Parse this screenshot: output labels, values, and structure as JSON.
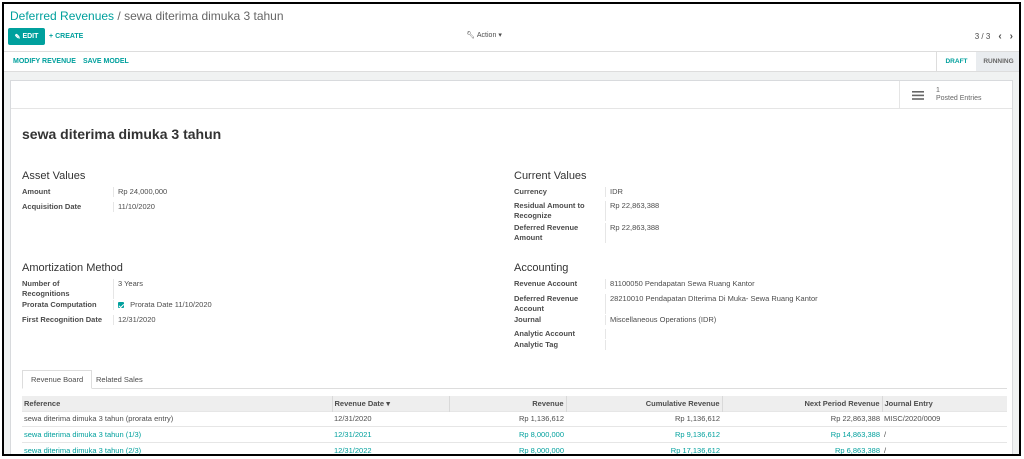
{
  "breadcrumb": {
    "parent": "Deferred Revenues",
    "separator": "/",
    "current": "sewa diterima dimuka 3 tahun"
  },
  "toolbar": {
    "edit_label": "EDIT",
    "create_label": "CREATE",
    "action_label": "Action",
    "pager": "3 / 3"
  },
  "header": {
    "modify_label": "MODIFY REVENUE",
    "save_model_label": "SAVE MODEL",
    "stages": [
      "DRAFT",
      "RUNNING"
    ],
    "active_stage": "RUNNING"
  },
  "stat": {
    "count": "1",
    "label": "Posted Entries"
  },
  "title": "sewa diterima dimuka 3 tahun",
  "asset_values": {
    "title": "Asset Values",
    "amount_label": "Amount",
    "amount": "Rp 24,000,000",
    "acq_label": "Acquisition Date",
    "acq": "11/10/2020"
  },
  "current_values": {
    "title": "Current Values",
    "currency_label": "Currency",
    "currency": "IDR",
    "residual_label_1": "Residual Amount to",
    "residual_label_2": "Recognize",
    "residual": "Rp 22,863,388",
    "deferred_label_1": "Deferred Revenue",
    "deferred_label_2": "Amount",
    "deferred": "Rp 22,863,388"
  },
  "amortization": {
    "title": "Amortization Method",
    "num_label_1": "Number of",
    "num_label_2": "Recognitions",
    "num": "3 Years",
    "prorata_label": "Prorata Computation",
    "prorata_date_label": "Prorata Date",
    "prorata_date": "11/10/2020",
    "first_label": "First Recognition Date",
    "first": "12/31/2020"
  },
  "accounting": {
    "title": "Accounting",
    "rev_acc_label": "Revenue Account",
    "rev_acc": "81100050 Pendapatan Sewa Ruang Kantor",
    "def_acc_label_1": "Deferred Revenue",
    "def_acc_label_2": "Account",
    "def_acc": "28210010 Pendapatan DIterima Di Muka- Sewa Ruang Kantor",
    "journal_label": "Journal",
    "journal": "Miscellaneous Operations (IDR)",
    "analytic_acc_label": "Analytic Account",
    "analytic_tag_label": "Analytic Tag"
  },
  "tabs": [
    "Revenue Board",
    "Related Sales"
  ],
  "table": {
    "headers": [
      "Reference",
      "Revenue Date",
      "Revenue",
      "Cumulative Revenue",
      "Next Period Revenue",
      "Journal Entry"
    ],
    "rows": [
      {
        "ref": "sewa diterima dimuka 3 tahun (prorata entry)",
        "date": "12/31/2020",
        "rev": "Rp 1,136,612",
        "cum": "Rp 1,136,612",
        "next": "Rp 22,863,388",
        "je": "MISC/2020/0009"
      },
      {
        "ref": "sewa diterima dimuka 3 tahun (1/3)",
        "date": "12/31/2021",
        "rev": "Rp 8,000,000",
        "cum": "Rp 9,136,612",
        "next": "Rp 14,863,388",
        "je": "/"
      },
      {
        "ref": "sewa diterima dimuka 3 tahun (2/3)",
        "date": "12/31/2022",
        "rev": "Rp 8,000,000",
        "cum": "Rp 17,136,612",
        "next": "Rp 6,863,388",
        "je": "/"
      }
    ]
  }
}
